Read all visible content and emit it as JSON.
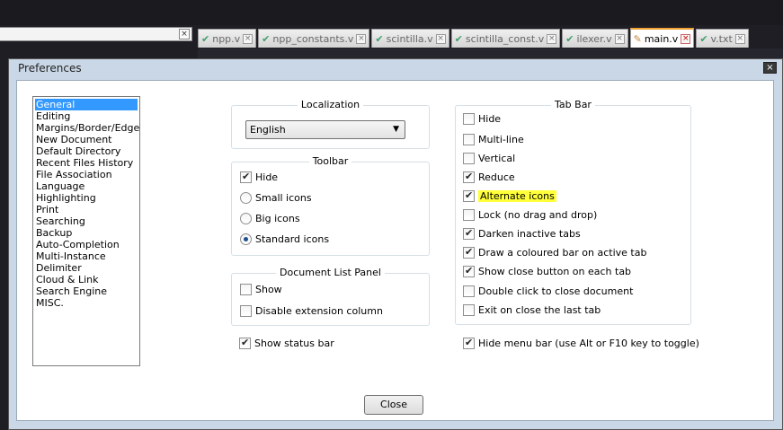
{
  "editor": {
    "find_close": "×",
    "tabs": [
      {
        "label": "npp.v",
        "state": "saved"
      },
      {
        "label": "npp_constants.v",
        "state": "saved"
      },
      {
        "label": "scintilla.v",
        "state": "saved"
      },
      {
        "label": "scintilla_const.v",
        "state": "saved"
      },
      {
        "label": "ilexer.v",
        "state": "saved"
      },
      {
        "label": "main.v",
        "state": "modified",
        "active": true
      },
      {
        "label": "v.txt",
        "state": "saved"
      }
    ],
    "tab_close": "×",
    "saved_icon": "✔",
    "modified_icon": "✎"
  },
  "dialog": {
    "title": "Preferences",
    "close_glyph": "×",
    "close_button": "Close"
  },
  "categories": [
    "General",
    "Editing",
    "Margins/Border/Edge",
    "New Document",
    "Default Directory",
    "Recent Files History",
    "File Association",
    "Language",
    "Highlighting",
    "Print",
    "Searching",
    "Backup",
    "Auto-Completion",
    "Multi-Instance",
    "Delimiter",
    "Cloud & Link",
    "Search Engine",
    "MISC."
  ],
  "selected_category": "General",
  "localization": {
    "title": "Localization",
    "value": "English",
    "arrow": "▼"
  },
  "toolbar": {
    "title": "Toolbar",
    "hide": {
      "label": "Hide",
      "checked": true
    },
    "radios": [
      {
        "label": "Small icons",
        "checked": false
      },
      {
        "label": "Big icons",
        "checked": false
      },
      {
        "label": "Standard icons",
        "checked": true
      }
    ]
  },
  "doc_list": {
    "title": "Document List Panel",
    "show": {
      "label": "Show",
      "checked": false
    },
    "disable_ext": {
      "label": "Disable extension column",
      "checked": false
    }
  },
  "status_bar": {
    "label": "Show status bar",
    "checked": true
  },
  "tab_bar": {
    "title": "Tab Bar",
    "options": [
      {
        "label": "Hide",
        "checked": false
      },
      {
        "label": "Multi-line",
        "checked": false
      },
      {
        "label": "Vertical",
        "checked": false
      },
      {
        "label": "Reduce",
        "checked": true
      },
      {
        "label": "Alternate icons",
        "checked": true,
        "highlighted": true
      },
      {
        "label": "Lock (no drag and drop)",
        "checked": false
      },
      {
        "label": "Darken inactive tabs",
        "checked": true
      },
      {
        "label": "Draw a coloured bar on active tab",
        "checked": true
      },
      {
        "label": "Show close button on each tab",
        "checked": true
      },
      {
        "label": "Double click to close document",
        "checked": false
      },
      {
        "label": "Exit on close the last tab",
        "checked": false
      }
    ]
  },
  "menu_bar": {
    "label": "Hide menu bar (use Alt or F10 key to toggle)",
    "checked": true
  },
  "colors": {
    "selection": "#3399ff",
    "highlight": "#ffff3a",
    "dialog_frame": "#c9d7e6"
  }
}
